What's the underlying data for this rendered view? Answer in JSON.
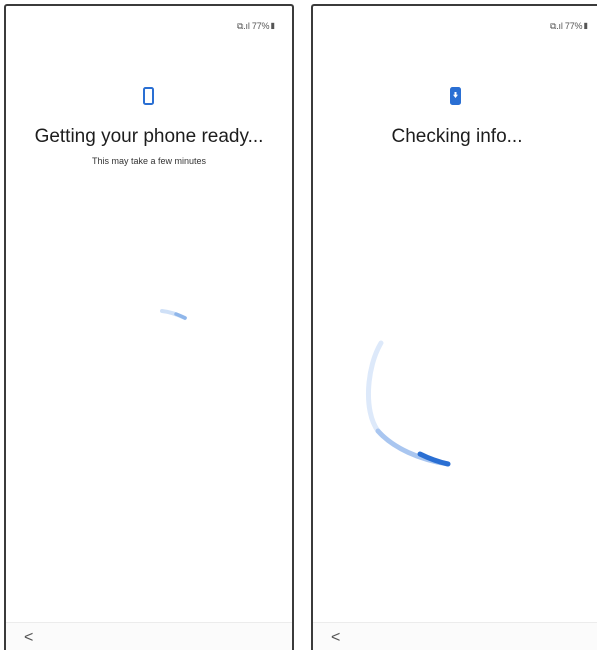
{
  "screens": [
    {
      "status_bar": "⧉.ıl 77%▮",
      "icon": "phone-icon",
      "title": "Getting your phone ready...",
      "subtitle": "This may take a few minutes",
      "back_label": "<"
    },
    {
      "status_bar": "⧉.ıl 77%▮",
      "icon": "phone-download-icon",
      "title": "Checking info...",
      "back_label": "<"
    }
  ],
  "colors": {
    "accent": "#2a6fd3",
    "spinner_light": "#cfe0f7"
  }
}
